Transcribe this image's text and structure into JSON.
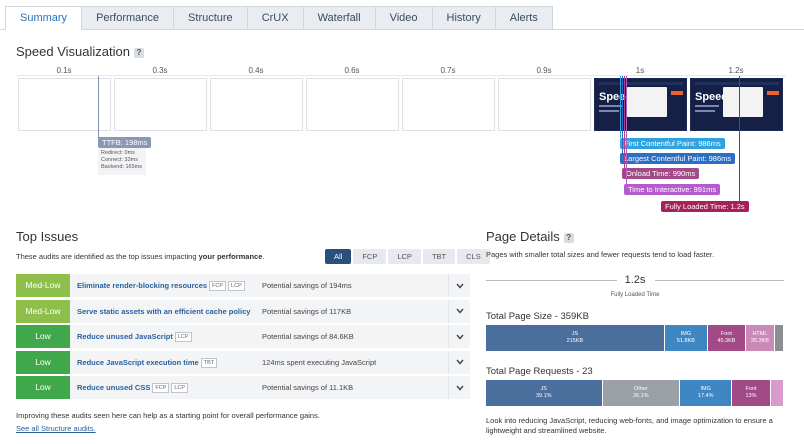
{
  "tabs": [
    "Summary",
    "Performance",
    "Structure",
    "CrUX",
    "Waterfall",
    "Video",
    "History",
    "Alerts"
  ],
  "speed_viz": {
    "title": "Speed Visualization",
    "help": "?",
    "ticks": [
      "0.1s",
      "0.3s",
      "0.4s",
      "0.6s",
      "0.7s",
      "0.9s",
      "1s",
      "1.2s"
    ],
    "screenshot_text": "Speed",
    "ttfb": {
      "label": "TTFB: 198ms",
      "redirect": "Redirect: 0ms",
      "connect": "Connect: 33ms",
      "backend": "Backend: 165ms"
    },
    "metrics": [
      {
        "label": "First Contentful Paint: 986ms",
        "color": "#2fa3e0"
      },
      {
        "label": "Largest Contentful Paint: 986ms",
        "color": "#2b6ec4"
      },
      {
        "label": "Onload Time: 990ms",
        "color": "#a24a86"
      },
      {
        "label": "Time to Interactive: 991ms",
        "color": "#b55ccc"
      },
      {
        "label": "Fully Loaded Time: 1.2s",
        "color": "#a6205a"
      }
    ]
  },
  "top_issues": {
    "title": "Top Issues",
    "desc_pre": "These audits are identified as the top issues impacting ",
    "desc_bold": "your performance",
    "desc_post": ".",
    "filters": [
      "All",
      "FCP",
      "LCP",
      "TBT",
      "CLS"
    ],
    "rows": [
      {
        "severity": "Med-Low",
        "name": "Eliminate render-blocking resources",
        "tags": [
          "FCP",
          "LCP"
        ],
        "savings": "Potential savings of 194ms"
      },
      {
        "severity": "Med-Low",
        "name": "Serve static assets with an efficient cache policy",
        "tags": [],
        "savings": "Potential savings of 117KB"
      },
      {
        "severity": "Low",
        "name": "Reduce unused JavaScript",
        "tags": [
          "LCP"
        ],
        "savings": "Potential savings of 84.6KB"
      },
      {
        "severity": "Low",
        "name": "Reduce JavaScript execution time",
        "tags": [
          "TBT"
        ],
        "savings": "124ms spent executing JavaScript"
      },
      {
        "severity": "Low",
        "name": "Reduce unused CSS",
        "tags": [
          "FCP",
          "LCP"
        ],
        "savings": "Potential savings of 11.1KB"
      }
    ],
    "footer": "Improving these audits seen here can help as a starting point for overall performance gains.",
    "link": "See all Structure audits."
  },
  "page_details": {
    "title": "Page Details",
    "help": "?",
    "desc": "Pages with smaller total sizes and fewer requests tend to load faster.",
    "fully_loaded_value": "1.2s",
    "fully_loaded_label": "Fully Loaded Time",
    "size_title": "Total Page Size - 359KB",
    "size_segments": [
      {
        "name": "JS",
        "value": "215KB",
        "color": "#4a6f9c",
        "share": 0.6
      },
      {
        "name": "IMG",
        "value": "51.8KB",
        "color": "#3f87c2",
        "share": 0.145
      },
      {
        "name": "Font",
        "value": "45.3KB",
        "color": "#a24a86",
        "share": 0.127
      },
      {
        "name": "HTML",
        "value": "35.3KB",
        "color": "#c98ab8",
        "share": 0.098
      },
      {
        "name": "",
        "value": "",
        "color": "#8a8f96",
        "share": 0.03
      }
    ],
    "requests_title": "Total Page Requests - 23",
    "request_segments": [
      {
        "name": "JS",
        "value": "39.1%",
        "color": "#4a6f9c",
        "share": 0.391
      },
      {
        "name": "Other",
        "value": "26.1%",
        "color": "#9aa0a6",
        "share": 0.261
      },
      {
        "name": "IMG",
        "value": "17.4%",
        "color": "#3f87c2",
        "share": 0.174
      },
      {
        "name": "Font",
        "value": "13%",
        "color": "#a24a86",
        "share": 0.13
      },
      {
        "name": "",
        "value": "",
        "color": "#d79ccc",
        "share": 0.044
      }
    ],
    "footer": "Look into reducing JavaScript, reducing web-fonts, and image optimization to ensure a lightweight and streamlined website."
  }
}
